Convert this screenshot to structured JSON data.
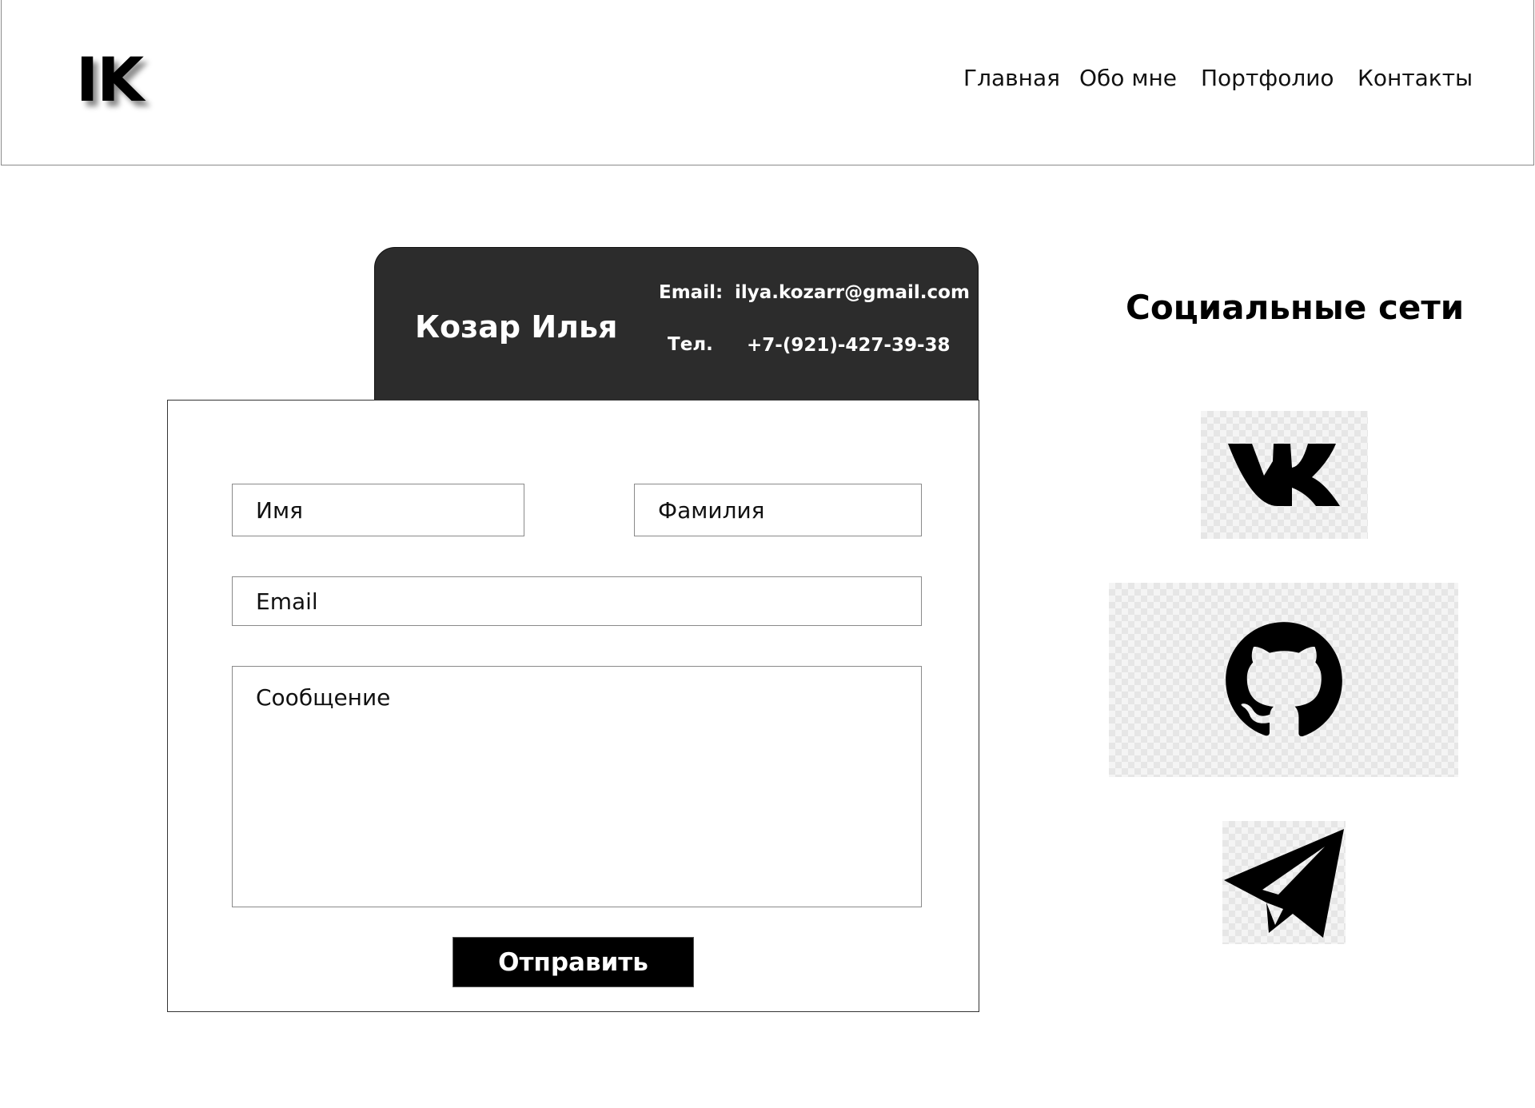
{
  "header": {
    "logo": "IK",
    "nav": [
      {
        "label": "Главная"
      },
      {
        "label": "Обо мне"
      },
      {
        "label": "Портфолио"
      },
      {
        "label": "Контакты"
      }
    ]
  },
  "card": {
    "name": "Козар Илья",
    "email_label": "Email:",
    "email_value": "ilya.kozarr@gmail.com",
    "phone_label": "Тел.",
    "phone_value": "+7-(921)-427-39-38"
  },
  "form": {
    "first_name_placeholder": "Имя",
    "last_name_placeholder": "Фамилия",
    "email_placeholder": "Email",
    "message_placeholder": "Сообщение",
    "submit_label": "Отправить"
  },
  "social": {
    "title": "Социальные сети",
    "links": [
      {
        "icon": "vk-icon"
      },
      {
        "icon": "github-icon"
      },
      {
        "icon": "telegram-icon"
      }
    ]
  }
}
